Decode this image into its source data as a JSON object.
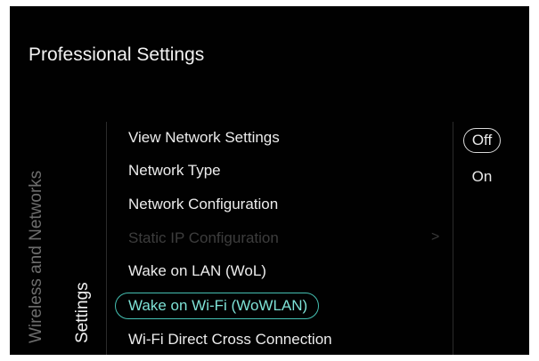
{
  "header": {
    "title": "Professional Settings"
  },
  "breadcrumb": {
    "level1": "Wireless and Networks",
    "level2": "Settings"
  },
  "menu": {
    "items": [
      {
        "label": "View Network Settings",
        "state": "enabled"
      },
      {
        "label": "Network Type",
        "state": "enabled"
      },
      {
        "label": "Network Configuration",
        "state": "enabled"
      },
      {
        "label": "Static IP Configuration",
        "state": "disabled",
        "has_submenu": true
      },
      {
        "label": "Wake on LAN (WoL)",
        "state": "enabled"
      },
      {
        "label": "Wake on Wi-Fi (WoWLAN)",
        "state": "highlighted"
      },
      {
        "label": "Wi-Fi Direct Cross Connection",
        "state": "enabled"
      }
    ],
    "submenu_indicator_icon": "chevron-right-icon"
  },
  "options": {
    "items": [
      {
        "label": "Off",
        "selected": true
      },
      {
        "label": "On",
        "selected": false
      }
    ]
  },
  "colors": {
    "background": "#010101",
    "highlight_accent": "#45c0b2",
    "highlight_text": "#7ee2d6",
    "disabled_text": "#3d3d3d"
  }
}
